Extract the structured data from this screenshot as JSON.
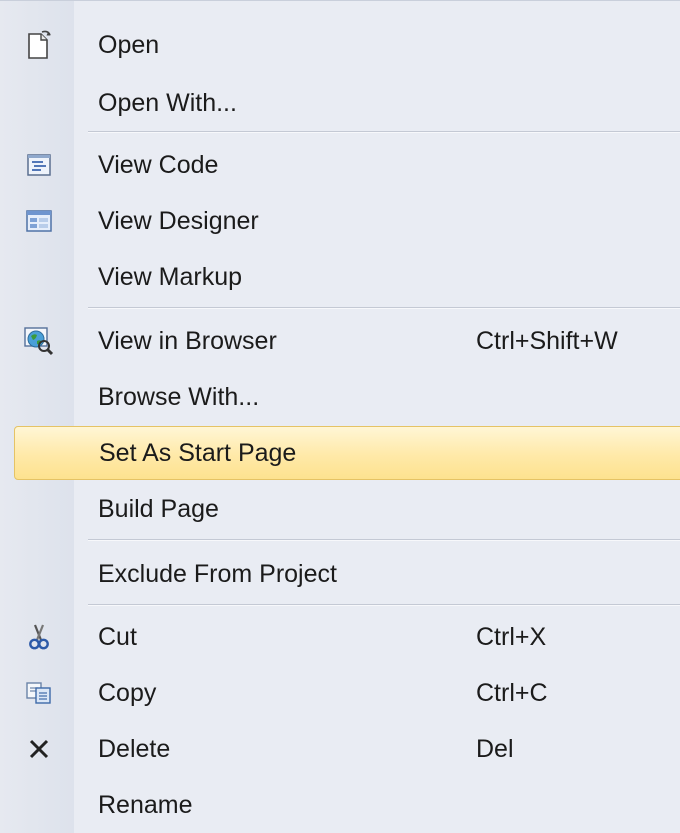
{
  "menu": {
    "items": [
      {
        "label": "Open",
        "icon": "open-file-icon"
      },
      {
        "label": "Open With..."
      },
      {
        "label": "View Code",
        "icon": "view-code-icon"
      },
      {
        "label": "View Designer",
        "icon": "view-designer-icon"
      },
      {
        "label": "View Markup"
      },
      {
        "label": "View in Browser",
        "shortcut": "Ctrl+Shift+W",
        "icon": "browser-icon"
      },
      {
        "label": "Browse With..."
      },
      {
        "label": "Set As Start Page",
        "highlighted": true
      },
      {
        "label": "Build Page"
      },
      {
        "label": "Exclude From Project"
      },
      {
        "label": "Cut",
        "shortcut": "Ctrl+X",
        "icon": "scissors-icon"
      },
      {
        "label": "Copy",
        "shortcut": "Ctrl+C",
        "icon": "copy-icon"
      },
      {
        "label": "Delete",
        "shortcut": "Del",
        "icon": "delete-icon"
      },
      {
        "label": "Rename"
      }
    ]
  },
  "colors": {
    "highlight_top": "#fff6d5",
    "highlight_bottom": "#fde28f",
    "highlight_border": "#e5c365",
    "menu_background": "#e9ecf3"
  }
}
